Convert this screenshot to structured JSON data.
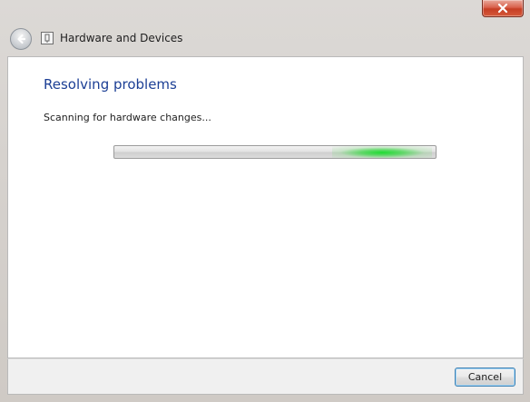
{
  "window": {
    "close_glyph": "x"
  },
  "navbar": {
    "title": "Hardware and Devices"
  },
  "main": {
    "heading": "Resolving problems",
    "status": "Scanning for hardware changes...",
    "progress": {
      "mode": "indeterminate",
      "glow_color": "#1edc32"
    }
  },
  "footer": {
    "cancel_label": "Cancel"
  },
  "colors": {
    "heading": "#1c3f95",
    "close_button": "#c63e24",
    "focus_border": "#3c7fb1"
  }
}
